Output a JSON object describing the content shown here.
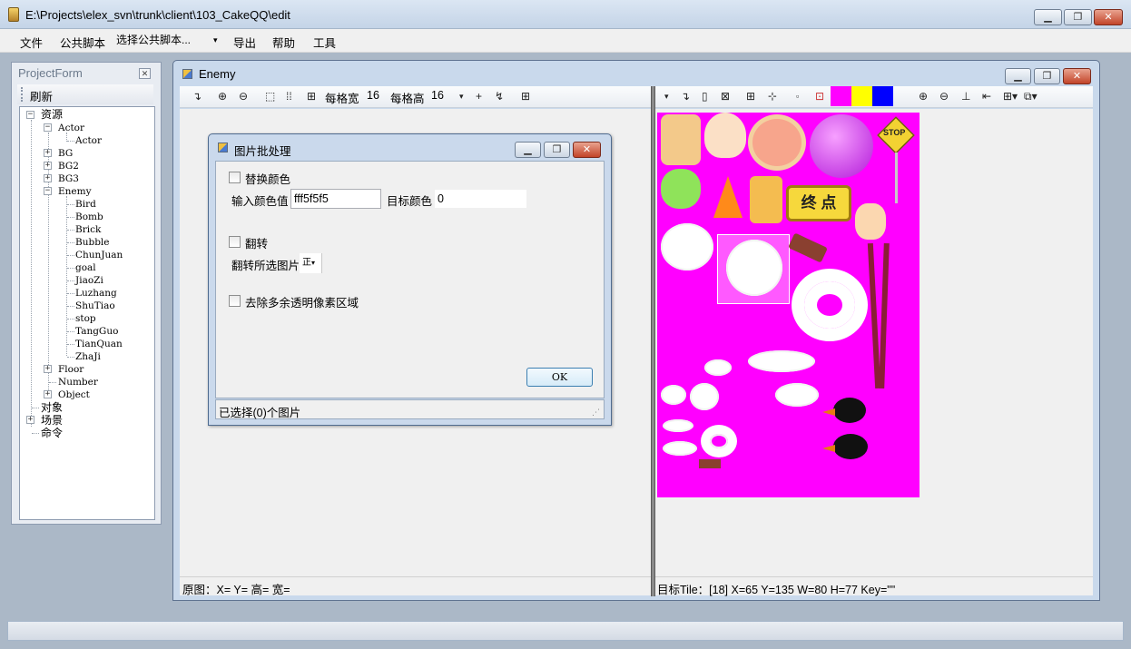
{
  "window": {
    "title": "E:\\Projects\\elex_svn\\trunk\\client\\103_CakeQQ\\edit"
  },
  "menu": {
    "file": "文件",
    "public_script": "公共脚本",
    "select_script": "选择公共脚本...",
    "export": "导出",
    "help": "帮助",
    "tools": "工具"
  },
  "project": {
    "title": "ProjectForm",
    "refresh": "刷新",
    "tree": {
      "resources": "资源",
      "actor": "Actor",
      "actor_child": "Actor",
      "bg": "BG",
      "bg2": "BG2",
      "bg3": "BG3",
      "enemy": "Enemy",
      "enemy_children": [
        "Bird",
        "Bomb",
        "Brick",
        "Bubble",
        "ChunJuan",
        "goal",
        "JiaoZi",
        "Luzhang",
        "ShuTiao",
        "stop",
        "TangGuo",
        "TianQuan",
        "ZhaJi"
      ],
      "floor": "Floor",
      "number": "Number",
      "object": "Object",
      "objects": "对象",
      "scenes": "场景",
      "commands": "命令"
    }
  },
  "editor": {
    "title": "Enemy",
    "toolbar": {
      "cell_width_label": "每格宽",
      "cell_width": "16",
      "cell_height_label": "每格高",
      "cell_height": "16"
    },
    "colors": [
      "#ff00ff",
      "#ffff00",
      "#0000ff"
    ],
    "status_left": "原图：X=  Y= 高= 宽=",
    "status_right": "目标Tile：[18] X=65 Y=135 W=80 H=77 Key=\"\""
  },
  "dialog": {
    "title": "图片批处理",
    "replace_color": "替换颜色",
    "input_color_label": "输入颜色值",
    "input_color_value": "fff5f5f5",
    "target_color_label": "目标颜色",
    "target_color_value": "0",
    "flip": "翻转",
    "flip_selected": "翻转所选图片",
    "flip_mode": "正",
    "remove_transparent": "去除多余透明像素区域",
    "ok": "OK",
    "status": "已选择(0)个图片"
  },
  "sprites": {
    "goal_text": "终 点",
    "stop_text": "STOP"
  }
}
